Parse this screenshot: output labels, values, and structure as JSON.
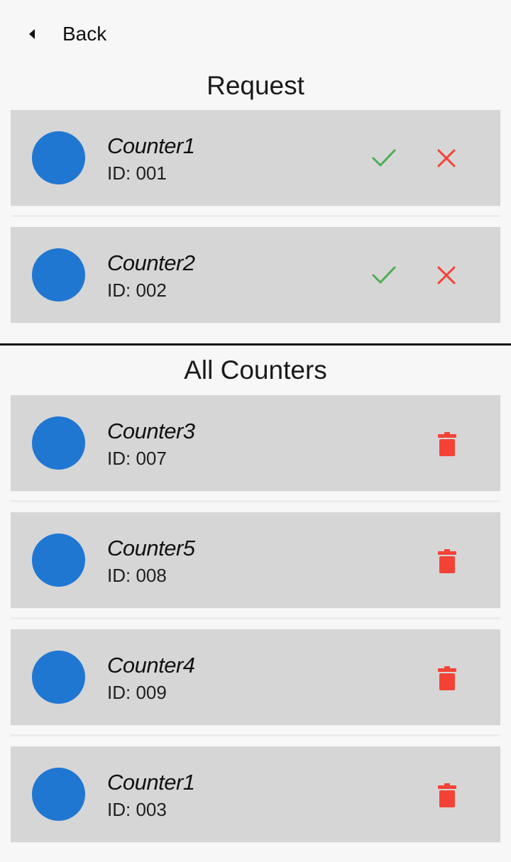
{
  "header": {
    "back_label": "Back"
  },
  "request_section": {
    "title": "Request",
    "items": [
      {
        "name": "Counter1",
        "id_text": "ID: 001"
      },
      {
        "name": "Counter2",
        "id_text": "ID: 002"
      }
    ]
  },
  "all_section": {
    "title": "All Counters",
    "items": [
      {
        "name": "Counter3",
        "id_text": "ID: 007"
      },
      {
        "name": "Counter5",
        "id_text": "ID: 008"
      },
      {
        "name": "Counter4",
        "id_text": "ID: 009"
      },
      {
        "name": "Counter1",
        "id_text": "ID: 003"
      }
    ]
  },
  "icons": {
    "back": "caret-left-icon",
    "accept": "check-icon",
    "reject": "close-icon",
    "delete": "trash-icon"
  },
  "colors": {
    "background": "#f7f7f7",
    "card": "#d6d6d6",
    "avatar": "#1f77d1",
    "accept": "#4caf50",
    "reject": "#f44336",
    "delete": "#f44336",
    "divider": "#111111"
  }
}
